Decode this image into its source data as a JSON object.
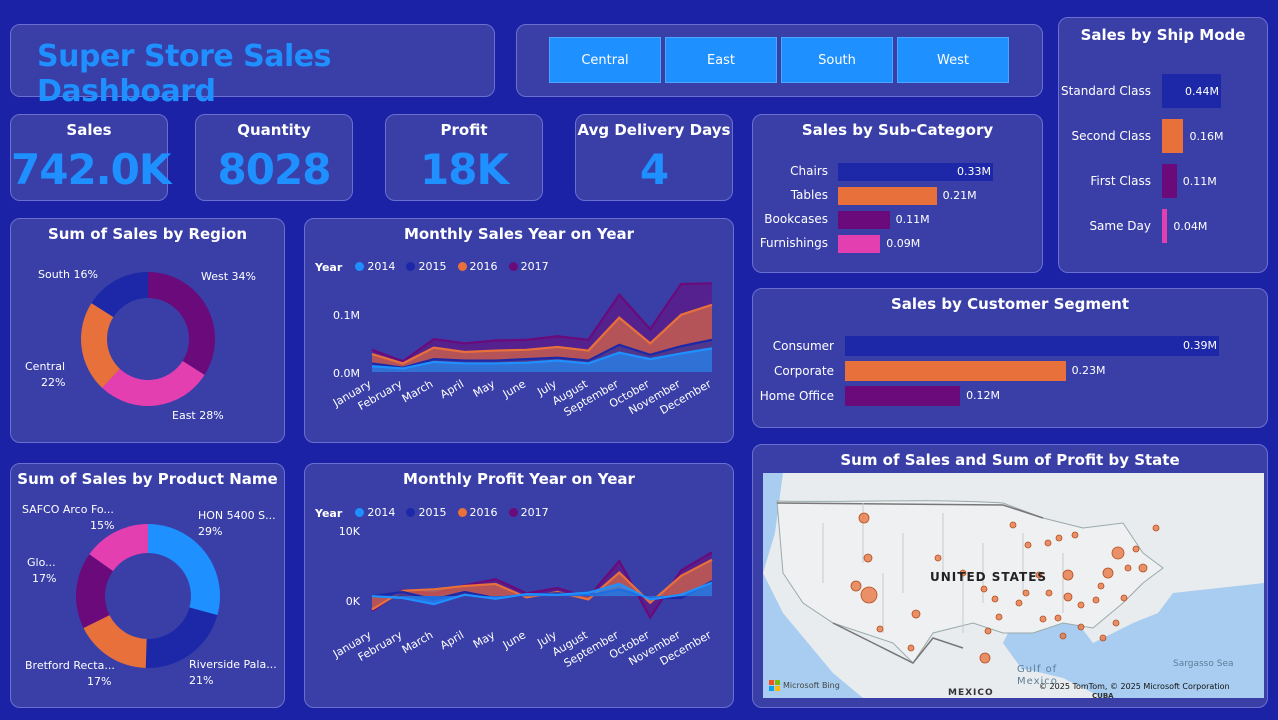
{
  "header": {
    "title": "Super Store Sales Dashboard"
  },
  "region_slicer": {
    "buttons": [
      "Central",
      "East",
      "South",
      "West"
    ]
  },
  "kpis": {
    "sales": {
      "label": "Sales",
      "value": "742.0K"
    },
    "quantity": {
      "label": "Quantity",
      "value": "8028"
    },
    "profit": {
      "label": "Profit",
      "value": "18K"
    },
    "delivery": {
      "label": "Avg Delivery Days",
      "value": "4"
    }
  },
  "colors": {
    "y2014": "#1e90ff",
    "y2015": "#1c28a8",
    "y2016": "#e8703a",
    "y2017": "#6b0a7a",
    "pink": "#e43fb0"
  },
  "ship_mode": {
    "title": "Sales by Ship Mode",
    "rows": [
      {
        "label": "Standard Class",
        "value": "0.44M",
        "amount": 0.44,
        "color": "#1c28a8"
      },
      {
        "label": "Second Class",
        "value": "0.16M",
        "amount": 0.16,
        "color": "#e8703a"
      },
      {
        "label": "First Class",
        "value": "0.11M",
        "amount": 0.11,
        "color": "#6b0a7a"
      },
      {
        "label": "Same Day",
        "value": "0.04M",
        "amount": 0.04,
        "color": "#e43fb0"
      }
    ]
  },
  "sub_category": {
    "title": "Sales by Sub-Category",
    "rows": [
      {
        "label": "Chairs",
        "value": "0.33M",
        "amount": 0.33,
        "color": "#1c28a8"
      },
      {
        "label": "Tables",
        "value": "0.21M",
        "amount": 0.21,
        "color": "#e8703a"
      },
      {
        "label": "Bookcases",
        "value": "0.11M",
        "amount": 0.11,
        "color": "#6b0a7a"
      },
      {
        "label": "Furnishings",
        "value": "0.09M",
        "amount": 0.09,
        "color": "#e43fb0"
      }
    ]
  },
  "segment": {
    "title": "Sales by Customer Segment",
    "rows": [
      {
        "label": "Consumer",
        "value": "0.39M",
        "amount": 0.39,
        "color": "#1c28a8"
      },
      {
        "label": "Corporate",
        "value": "0.23M",
        "amount": 0.23,
        "color": "#e8703a"
      },
      {
        "label": "Home Office",
        "value": "0.12M",
        "amount": 0.12,
        "color": "#6b0a7a"
      }
    ]
  },
  "region_donut": {
    "title": "Sum of Sales by Region",
    "labels": {
      "west": "West 34%",
      "east": "East 28%",
      "central_name": "Central",
      "central_pct": "22%",
      "south": "South 16%"
    }
  },
  "product_donut": {
    "title": "Sum of Sales by Product Name",
    "labels": {
      "hon": "HON 5400 S...",
      "hon_pct": "29%",
      "riverside": "Riverside Pala...",
      "riverside_pct": "21%",
      "bretford": "Bretford Recta...",
      "bretford_pct": "17%",
      "glo": "Glo...",
      "glo_pct": "17%",
      "safco": "SAFCO Arco Fo...",
      "safco_pct": "15%"
    }
  },
  "chart_data": [
    {
      "type": "pie",
      "title": "Sum of Sales by Region",
      "categories": [
        "West",
        "East",
        "Central",
        "South"
      ],
      "values": [
        34,
        28,
        22,
        16
      ],
      "colors": [
        "#6b0a7a",
        "#e43fb0",
        "#e8703a",
        "#1c28a8"
      ]
    },
    {
      "type": "pie",
      "title": "Sum of Sales by Product Name",
      "categories": [
        "HON 5400 S...",
        "Riverside Pala...",
        "Bretford Recta...",
        "Glo...",
        "SAFCO Arco Fo..."
      ],
      "values": [
        29,
        21,
        17,
        17,
        15
      ],
      "colors": [
        "#1e90ff",
        "#1c28a8",
        "#e8703a",
        "#6b0a7a",
        "#e43fb0"
      ]
    },
    {
      "type": "area",
      "title": "Monthly Sales Year on Year",
      "legend_title": "Year",
      "x": [
        "January",
        "February",
        "March",
        "April",
        "May",
        "June",
        "July",
        "August",
        "September",
        "October",
        "November",
        "December"
      ],
      "y_ticks": [
        "0.0M",
        "0.1M"
      ],
      "ylim": [
        0,
        0.13
      ],
      "series": [
        {
          "name": "2014",
          "values": [
            0.008,
            0.005,
            0.014,
            0.012,
            0.012,
            0.013,
            0.016,
            0.012,
            0.027,
            0.018,
            0.026,
            0.033
          ]
        },
        {
          "name": "2015",
          "values": [
            0.012,
            0.006,
            0.018,
            0.016,
            0.016,
            0.018,
            0.02,
            0.016,
            0.038,
            0.024,
            0.036,
            0.045
          ]
        },
        {
          "name": "2016",
          "values": [
            0.025,
            0.012,
            0.034,
            0.028,
            0.03,
            0.031,
            0.035,
            0.03,
            0.076,
            0.04,
            0.08,
            0.094
          ]
        },
        {
          "name": "2017",
          "values": [
            0.031,
            0.015,
            0.046,
            0.04,
            0.044,
            0.045,
            0.05,
            0.045,
            0.108,
            0.06,
            0.123,
            0.124
          ]
        }
      ]
    },
    {
      "type": "area",
      "title": "Monthly Profit Year on Year",
      "legend_title": "Year",
      "x": [
        "January",
        "February",
        "March",
        "April",
        "May",
        "June",
        "July",
        "August",
        "September",
        "October",
        "November",
        "December"
      ],
      "y_ticks": [
        "0K",
        "10K"
      ],
      "ylim": [
        -4000,
        11000
      ],
      "series": [
        {
          "name": "2014",
          "values": [
            0,
            -300,
            -1200,
            200,
            -400,
            300,
            200,
            500,
            1800,
            -500,
            200,
            2000
          ]
        },
        {
          "name": "2015",
          "values": [
            0,
            600,
            -500,
            600,
            -300,
            200,
            400,
            100,
            1000,
            -300,
            -300,
            2200
          ]
        },
        {
          "name": "2016",
          "values": [
            -2000,
            800,
            1000,
            1500,
            1800,
            -200,
            600,
            -500,
            3500,
            -1000,
            3000,
            5400
          ]
        },
        {
          "name": "2017",
          "values": [
            -2200,
            900,
            300,
            1600,
            2500,
            400,
            1200,
            -200,
            5200,
            -3200,
            3800,
            6500
          ]
        }
      ]
    }
  ],
  "map": {
    "title": "Sum of Sales and Sum of Profit by State",
    "country_label": "UNITED STATES",
    "mexico_label": "MEXICO",
    "gulf_label": "Gulf of",
    "gulf_label2": "Mexico",
    "sea_label": "Sargasso Sea",
    "cuba_label": "CUBA",
    "attribution": "© 2025 TomTom, © 2025 Microsoft Corporation",
    "logo": "Microsoft Bing"
  }
}
